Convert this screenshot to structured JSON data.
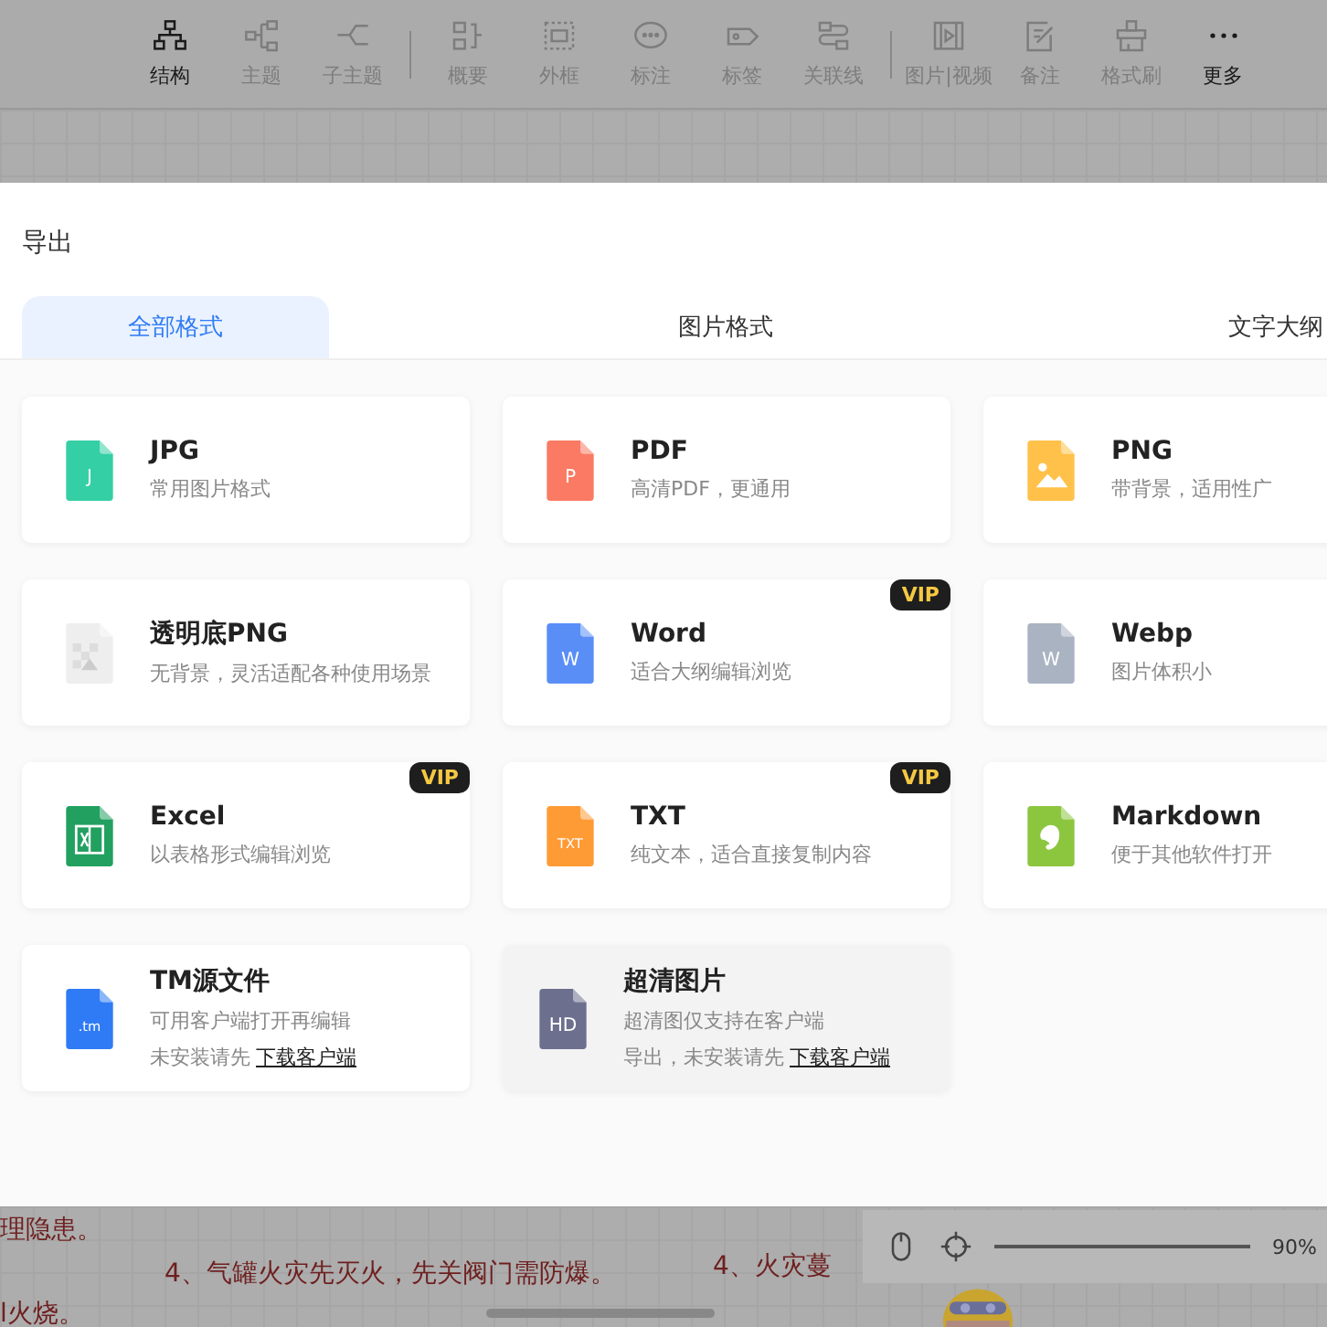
{
  "toolbar": [
    {
      "label": "结构",
      "disabled": false
    },
    {
      "label": "主题",
      "disabled": true
    },
    {
      "label": "子主题",
      "disabled": true
    },
    {
      "label": "概要",
      "disabled": true
    },
    {
      "label": "外框",
      "disabled": true
    },
    {
      "label": "标注",
      "disabled": true
    },
    {
      "label": "标签",
      "disabled": true
    },
    {
      "label": "关联线",
      "disabled": true
    },
    {
      "label": "图片|视频",
      "disabled": true
    },
    {
      "label": "备注",
      "disabled": true
    },
    {
      "label": "格式刷",
      "disabled": true
    },
    {
      "label": "更多",
      "disabled": false
    }
  ],
  "dialog": {
    "title": "导出",
    "tabs": [
      {
        "label": "全部格式",
        "selected": true
      },
      {
        "label": "图片格式",
        "selected": false
      },
      {
        "label": "文字大纲",
        "selected": false
      }
    ],
    "formats": [
      {
        "title": "JPG",
        "description": "常用图片格式",
        "icon_text": "J",
        "color": "#35cfa5",
        "vip": false,
        "highlighted": false
      },
      {
        "title": "PDF",
        "description": "高清PDF，更通用",
        "icon_text": "P",
        "color": "#fa7a63",
        "vip": false,
        "highlighted": false
      },
      {
        "title": "PNG",
        "description": "带背景，适用性广",
        "color": "#ffc14a",
        "vip": false,
        "highlighted": false
      },
      {
        "title": "透明底PNG",
        "description": "无背景，灵活适配各种使用场景",
        "color": "#eeeeee",
        "vip": false,
        "highlighted": false
      },
      {
        "title": "Word",
        "description": "适合大纲编辑浏览",
        "icon_text": "W",
        "color": "#5a8ef7",
        "vip": true,
        "vip_text": "VIP",
        "highlighted": false
      },
      {
        "title": "Webp",
        "description": "图片体积小",
        "icon_text": "W",
        "color": "#a9b3c2",
        "vip": false,
        "highlighted": false
      },
      {
        "title": "Excel",
        "description": "以表格形式编辑浏览",
        "color": "#22a060",
        "vip": true,
        "vip_text": "VIP",
        "highlighted": false
      },
      {
        "title": "TXT",
        "description": "纯文本，适合直接复制内容",
        "icon_text": "TXT",
        "color": "#ff9b35",
        "vip": true,
        "vip_text": "VIP",
        "highlighted": false
      },
      {
        "title": "Markdown",
        "description": "便于其他软件打开",
        "color": "#8cc63f",
        "vip": false,
        "highlighted": false
      },
      {
        "title": "TM源文件",
        "description": "可用客户端打开再编辑",
        "note": "未安装请先",
        "link": "下载客户端",
        "icon_text": ".tm",
        "color": "#2f7bf5",
        "vip": false,
        "highlighted": false
      },
      {
        "title": "超清图片",
        "description": "超清图仅支持在客户端",
        "note": "导出，未安装请先",
        "link": "下载客户端",
        "icon_text": "HD",
        "color": "#6c6f8e",
        "vip": false,
        "highlighted": true
      }
    ]
  },
  "canvas_texts": [
    {
      "text": "理隐患。"
    },
    {
      "text": "4、气罐火灾先灭火，先关阀门需防爆。"
    },
    {
      "text": "4、火灾蔓"
    },
    {
      "text": "l火烧。"
    }
  ],
  "zoom": {
    "value": "90%"
  }
}
